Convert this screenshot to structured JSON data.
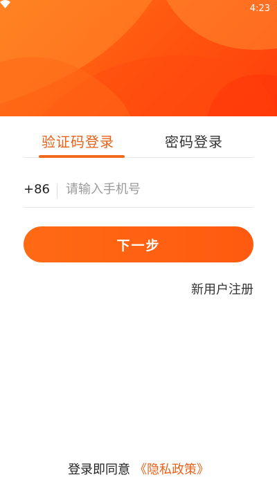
{
  "status_bar": {
    "time": "4:23",
    "icons": [
      "wifi-icon"
    ]
  },
  "colors": {
    "accent": "#ef6a1c",
    "header_gradient_start": "#ff7a1a",
    "header_gradient_end": "#ff3d0a",
    "button": "#ff5a10"
  },
  "tabs": [
    {
      "label": "验证码登录",
      "active": true
    },
    {
      "label": "密码登录",
      "active": false
    }
  ],
  "phone": {
    "country_code": "+86",
    "placeholder": "请输入手机号",
    "value": ""
  },
  "next_button": {
    "label": "下一步"
  },
  "register_link": {
    "label": "新用户注册"
  },
  "agreement": {
    "prefix": "登录即同意",
    "policy_link": "《隐私政策》"
  }
}
